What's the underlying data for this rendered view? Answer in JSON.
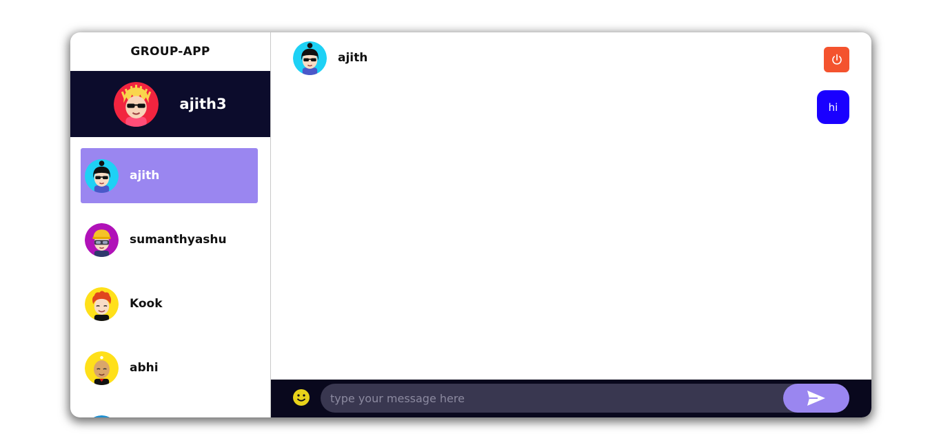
{
  "app": {
    "title": "GROUP-APP"
  },
  "current_user": {
    "name": "ajith3",
    "avatar_icon": "avatar-blonde-sunglasses-icon"
  },
  "users": [
    {
      "name": "ajith",
      "active": true,
      "avatar_icon": "avatar-black-hair-sunglasses-icon"
    },
    {
      "name": "sumanthyashu",
      "active": false,
      "avatar_icon": "avatar-goggles-icon"
    },
    {
      "name": "Kook",
      "active": false,
      "avatar_icon": "avatar-red-hair-icon"
    },
    {
      "name": "abhi",
      "active": false,
      "avatar_icon": "avatar-bald-icon"
    }
  ],
  "chat": {
    "header_name": "ajith",
    "messages": [
      {
        "text": "hi",
        "sent_by_me": true
      }
    ],
    "input_placeholder": "type your message here"
  },
  "colors": {
    "accent": "#9a86f0",
    "header_dark": "#0c0c2c",
    "message_bubble": "#1a00ff",
    "logout": "#f4532e"
  }
}
